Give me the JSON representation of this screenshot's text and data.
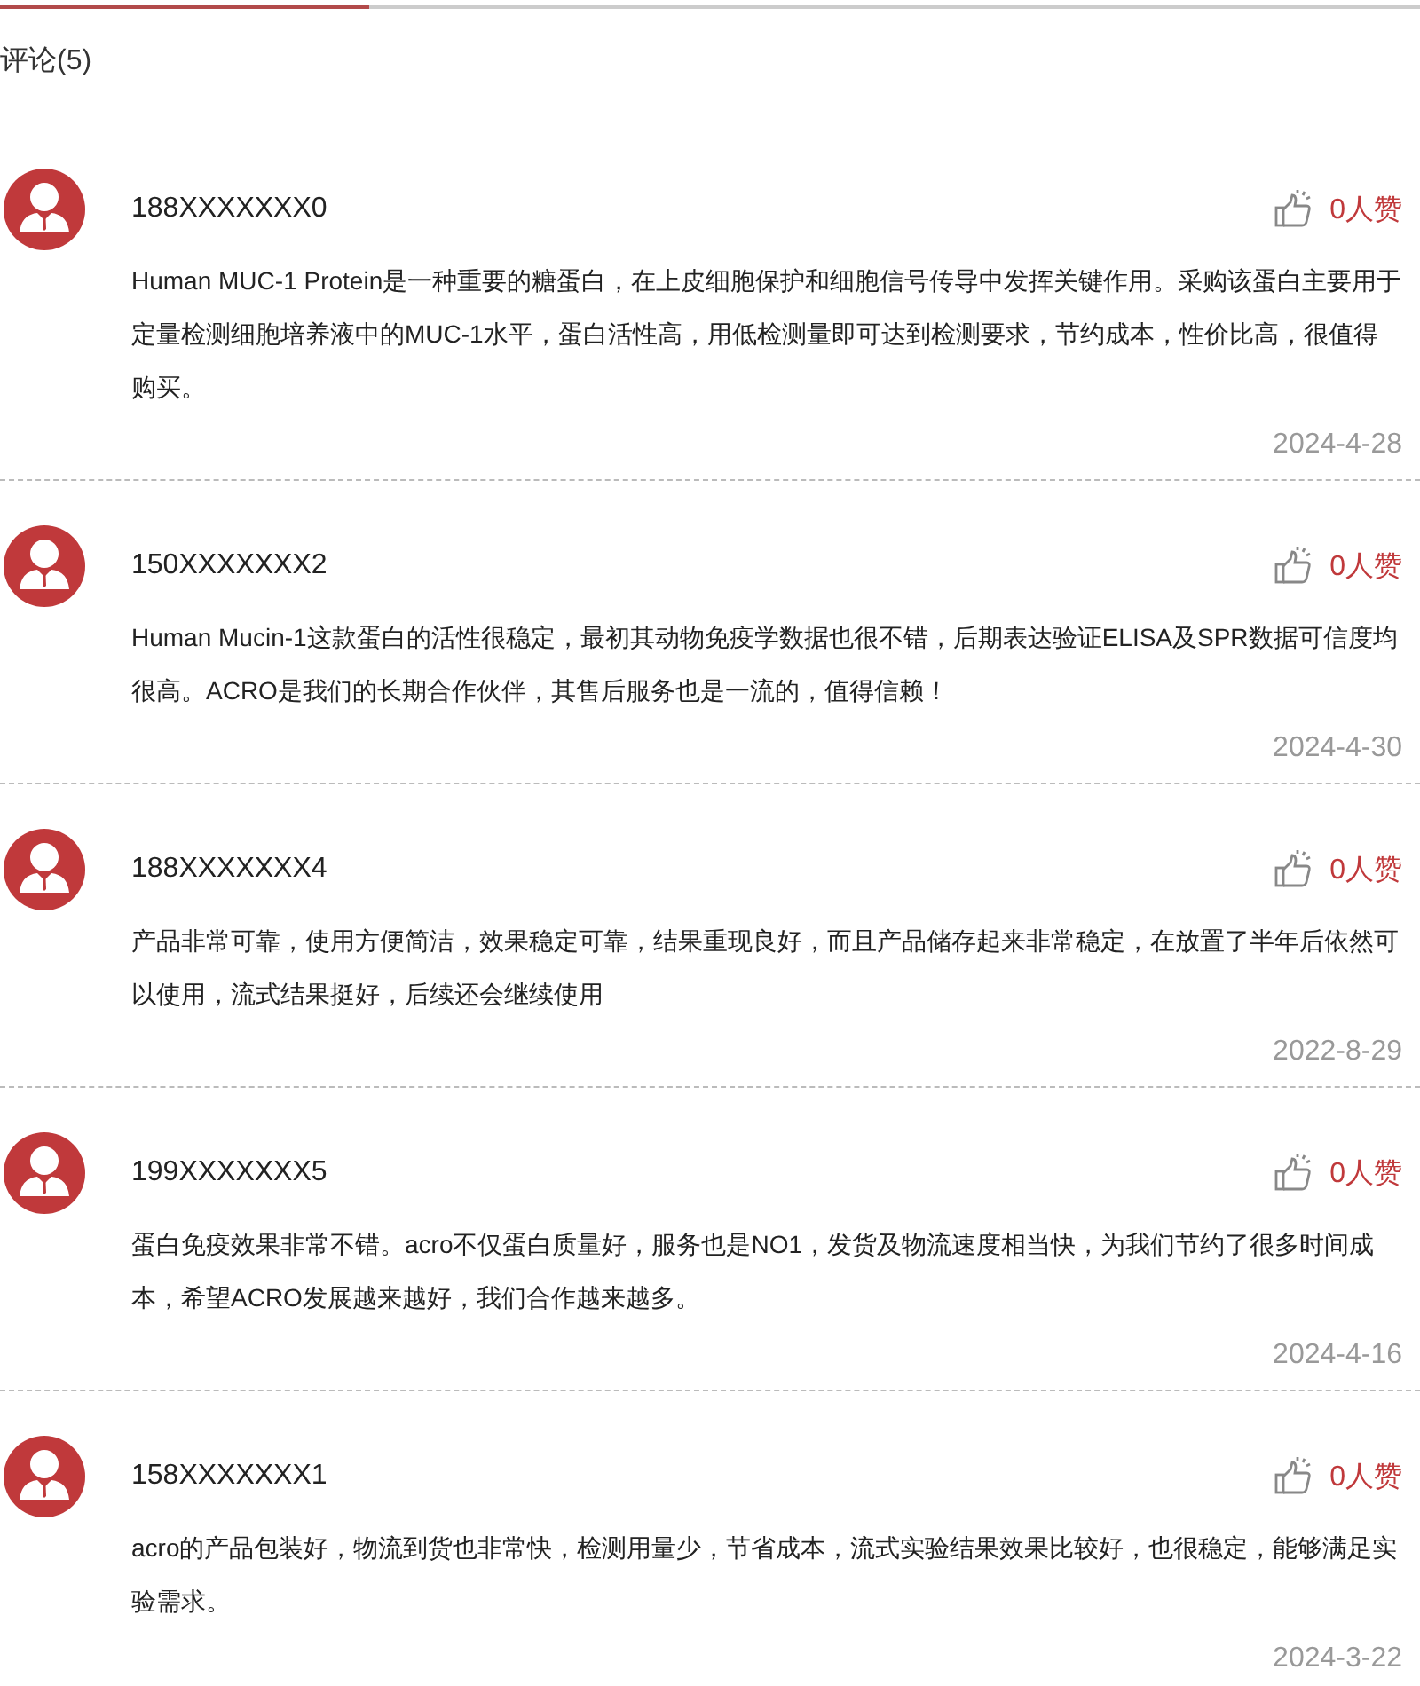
{
  "title": "评论(5)",
  "comments": [
    {
      "user": "188XXXXXXX0",
      "likes": "0人赞",
      "text": "Human MUC-1 Protein是一种重要的糖蛋白，在上皮细胞保护和细胞信号传导中发挥关键作用。采购该蛋白主要用于定量检测细胞培养液中的MUC-1水平，蛋白活性高，用低检测量即可达到检测要求，节约成本，性价比高，很值得购买。",
      "date": "2024-4-28"
    },
    {
      "user": "150XXXXXXX2",
      "likes": "0人赞",
      "text": "Human Mucin-1这款蛋白的活性很稳定，最初其动物免疫学数据也很不错，后期表达验证ELISA及SPR数据可信度均很高。ACRO是我们的长期合作伙伴，其售后服务也是一流的，值得信赖！",
      "date": "2024-4-30"
    },
    {
      "user": "188XXXXXXX4",
      "likes": "0人赞",
      "text": "产品非常可靠，使用方便简洁，效果稳定可靠，结果重现良好，而且产品储存起来非常稳定，在放置了半年后依然可以使用，流式结果挺好，后续还会继续使用",
      "date": "2022-8-29"
    },
    {
      "user": "199XXXXXXX5",
      "likes": "0人赞",
      "text": "蛋白免疫效果非常不错。acro不仅蛋白质量好，服务也是NO1，发货及物流速度相当快，为我们节约了很多时间成本，希望ACRO发展越来越好，我们合作越来越多。",
      "date": "2024-4-16"
    },
    {
      "user": "158XXXXXXX1",
      "likes": "0人赞",
      "text": "acro的产品包装好，物流到货也非常快，检测用量少，节省成本，流式实验结果效果比较好，也很稳定，能够满足实验需求。",
      "date": "2024-3-22"
    }
  ]
}
